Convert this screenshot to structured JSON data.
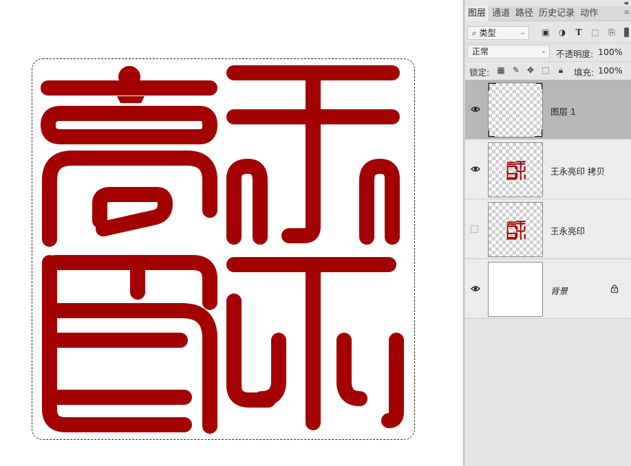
{
  "colors": {
    "seal_red": "#a30000",
    "panel_bg": "#e6e6e6",
    "selected_layer": "#b8b8b8"
  },
  "canvas": {
    "selection": "marquee-selection",
    "artwork": "seal-wang-yong-liang"
  },
  "panel": {
    "tabs": [
      "图层",
      "通道",
      "路径",
      "历史记录",
      "动作"
    ],
    "active_tab": "图层",
    "filter": {
      "label": "类型",
      "icons": [
        "image-filter-icon",
        "adjustment-filter-icon",
        "type-filter-icon",
        "shape-filter-icon",
        "smart-object-filter-icon"
      ]
    },
    "blend_mode": "正常",
    "opacity_label": "不透明度:",
    "opacity_value": "100%",
    "lock_label": "锁定:",
    "fill_label": "填充:",
    "fill_value": "100%",
    "lock_icons": [
      "lock-transparent-icon",
      "lock-pixels-icon",
      "lock-position-icon",
      "lock-artboard-icon",
      "lock-all-icon"
    ]
  },
  "layers": [
    {
      "name": "图层 1",
      "visible": true,
      "selected": true,
      "thumbnail": "transparent"
    },
    {
      "name": "王永亮印 拷贝",
      "visible": true,
      "selected": false,
      "thumbnail": "seal"
    },
    {
      "name": "王永亮印",
      "visible": false,
      "selected": false,
      "thumbnail": "seal"
    },
    {
      "name": "背景",
      "visible": true,
      "selected": false,
      "thumbnail": "white",
      "locked": true
    }
  ]
}
